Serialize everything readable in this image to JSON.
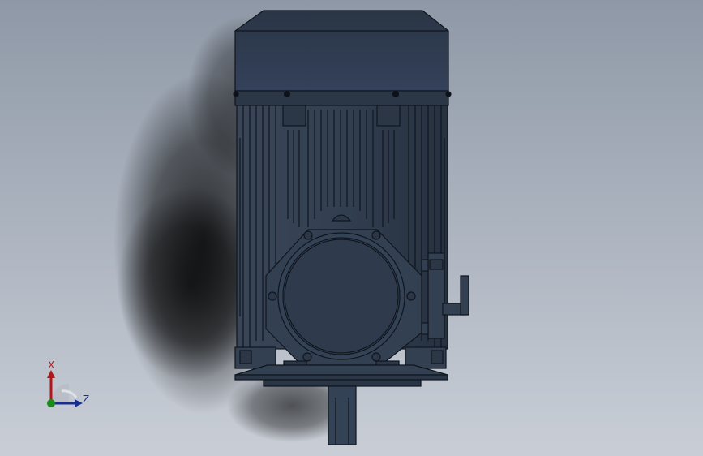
{
  "viewport": {
    "background_top": "#8f98a6",
    "background_bottom": "#c9ced6",
    "model_color": "#2f3b4d",
    "edge_color": "#0f151d"
  },
  "model": {
    "icon": "electric-motor-front-view"
  },
  "triad": {
    "x_label": "X",
    "z_label": "Z",
    "x_color": "#b01818",
    "y_color": "#1c8a1c",
    "z_color": "#1a2f8c"
  }
}
